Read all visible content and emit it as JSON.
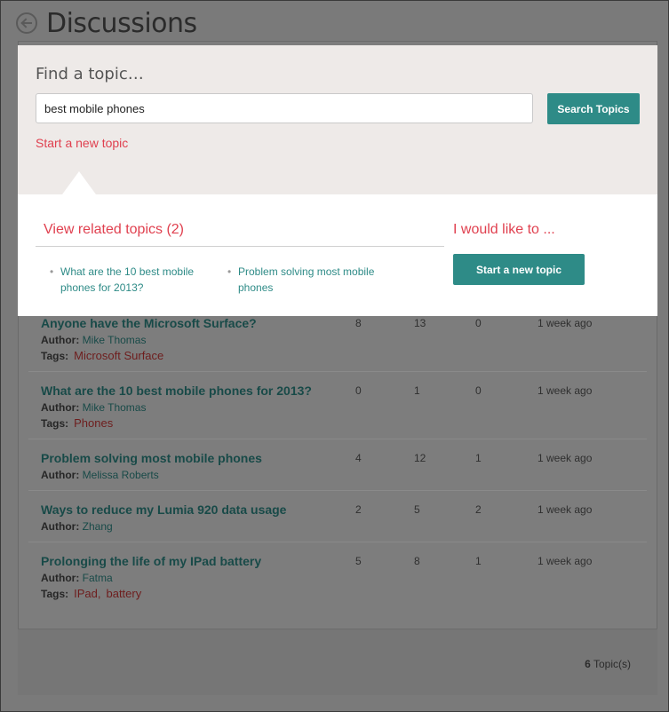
{
  "page": {
    "title": "Discussions"
  },
  "search": {
    "heading": "Find a topic…",
    "query": "best mobile phones",
    "button_label": "Search Topics",
    "new_topic_link": "Start a new topic"
  },
  "related": {
    "heading": "View related topics (2)",
    "items": [
      "What are the 10 best mobile phones for 2013?",
      "Problem solving most mobile phones"
    ]
  },
  "actions": {
    "heading": "I would like to ...",
    "start_button": "Start a new topic"
  },
  "topics": [
    {
      "title": "Anyone have the Microsoft Surface?",
      "author_label": "Author:",
      "author": "Mike Thomas",
      "tags_label": "Tags:",
      "tags": [
        "Microsoft Surface"
      ],
      "c1": "8",
      "c2": "13",
      "c3": "0",
      "time": "1 week ago"
    },
    {
      "title": "What are the 10 best mobile phones for 2013?",
      "author_label": "Author:",
      "author": "Mike Thomas",
      "tags_label": "Tags:",
      "tags": [
        "Phones"
      ],
      "c1": "0",
      "c2": "1",
      "c3": "0",
      "time": "1 week ago"
    },
    {
      "title": "Problem solving most mobile phones",
      "author_label": "Author:",
      "author": "Melissa Roberts",
      "c1": "4",
      "c2": "12",
      "c3": "1",
      "time": "1 week ago"
    },
    {
      "title": "Ways to reduce my Lumia 920 data usage",
      "author_label": "Author:",
      "author": "Zhang",
      "c1": "2",
      "c2": "5",
      "c3": "2",
      "time": "1 week ago"
    },
    {
      "title": "Prolonging the life of my IPad battery",
      "author_label": "Author:",
      "author": "Fatma",
      "tags_label": "Tags:",
      "tags": [
        "IPad,",
        "battery"
      ],
      "c1": "5",
      "c2": "8",
      "c3": "1",
      "time": "1 week ago"
    }
  ],
  "footer": {
    "count": "6",
    "count_suffix": "Topic(s)"
  },
  "colors": {
    "accent": "#2e8b87",
    "link_red": "#e0404f",
    "overlay": "#7a7a7a"
  }
}
